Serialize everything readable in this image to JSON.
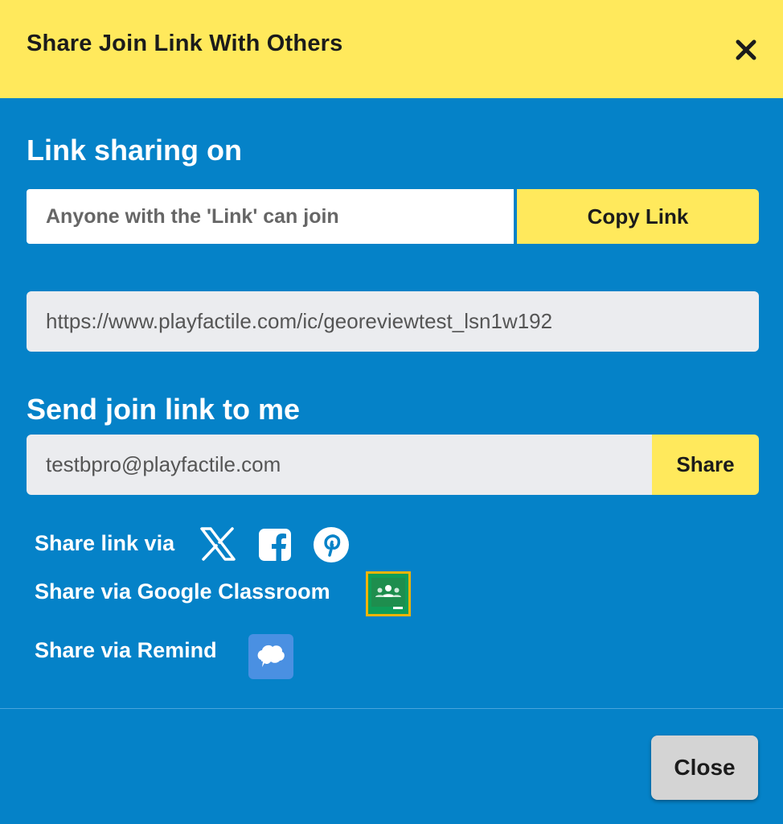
{
  "header": {
    "title": "Share Join Link With Others",
    "close_icon": "close-icon"
  },
  "link_section": {
    "heading": "Link sharing on",
    "status_text": "Anyone with the 'Link' can join",
    "copy_label": "Copy Link",
    "url": "https://www.playfactile.com/ic/georeviewtest_lsn1w192"
  },
  "send_section": {
    "heading": "Send join link to me",
    "email_value": "testbpro@playfactile.com",
    "share_label": "Share"
  },
  "share_options": {
    "social_label": "Share link via",
    "social_icons": [
      "x-icon",
      "facebook-icon",
      "pinterest-icon"
    ],
    "classroom_label": "Share via Google Classroom",
    "classroom_icon": "google-classroom-icon",
    "remind_label": "Share via Remind",
    "remind_icon": "remind-icon"
  },
  "footer": {
    "close_label": "Close"
  },
  "colors": {
    "accent_yellow": "#ffe95c",
    "panel_blue": "#0582c8",
    "field_gray": "#ebecef",
    "close_gray": "#d4d4d4",
    "classroom_green": "#0f9d58",
    "classroom_border": "#f4b400",
    "remind_blue": "#4a90e2"
  }
}
